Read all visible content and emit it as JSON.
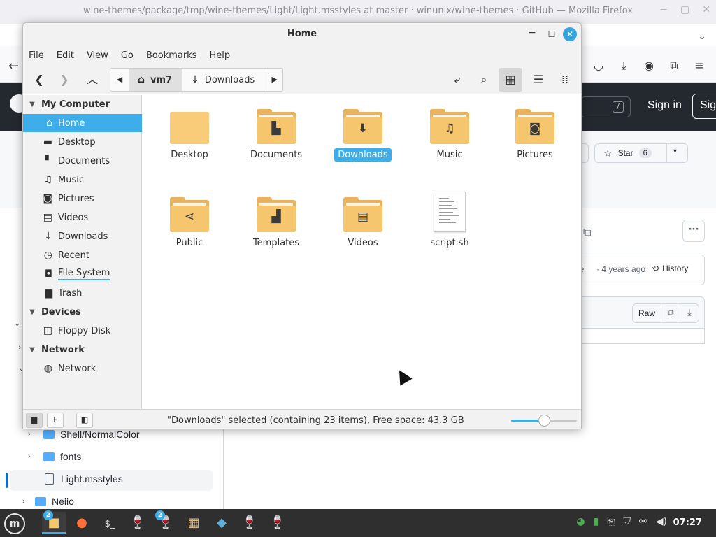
{
  "firefox": {
    "window_title": "wine-themes/package/tmp/wine-themes/Light/Light.msstyles at master · winunix/wine-themes · GitHub — Mozilla Firefox"
  },
  "github": {
    "sign_in": "Sign in",
    "sign_up": "Sig",
    "search_shortcut": "/",
    "star_label": "Star",
    "star_count": "6",
    "commit_author": "pe",
    "commit_time": "· 4 years ago",
    "history_label": "History",
    "raw_label": "Raw",
    "tree": [
      {
        "name": "Shell/NormalColor",
        "type": "folder"
      },
      {
        "name": "fonts",
        "type": "folder"
      },
      {
        "name": "Light.msstyles",
        "type": "file"
      },
      {
        "name": "Neiio",
        "type": "folder"
      }
    ]
  },
  "file_manager": {
    "title": "Home",
    "menu": [
      "File",
      "Edit",
      "View",
      "Go",
      "Bookmarks",
      "Help"
    ],
    "path": [
      {
        "label": "vm7",
        "icon": "home-icon",
        "active": true
      },
      {
        "label": "Downloads",
        "icon": "download-icon",
        "active": false
      }
    ],
    "sidebar": {
      "sections": [
        {
          "title": "My Computer",
          "items": [
            {
              "label": "Home",
              "icon": "home-icon",
              "selected": true
            },
            {
              "label": "Desktop",
              "icon": "desktop-icon"
            },
            {
              "label": "Documents",
              "icon": "document-icon"
            },
            {
              "label": "Music",
              "icon": "music-icon"
            },
            {
              "label": "Pictures",
              "icon": "camera-icon"
            },
            {
              "label": "Videos",
              "icon": "film-icon"
            },
            {
              "label": "Downloads",
              "icon": "download-icon"
            },
            {
              "label": "Recent",
              "icon": "clock-icon"
            },
            {
              "label": "File System",
              "icon": "drive-icon"
            },
            {
              "label": "Trash",
              "icon": "trash-icon"
            }
          ]
        },
        {
          "title": "Devices",
          "items": [
            {
              "label": "Floppy Disk",
              "icon": "floppy-icon"
            }
          ]
        },
        {
          "title": "Network",
          "items": [
            {
              "label": "Network",
              "icon": "globe-icon"
            }
          ]
        }
      ]
    },
    "items": [
      {
        "label": "Desktop",
        "kind": "folder-plain"
      },
      {
        "label": "Documents",
        "kind": "folder-documents"
      },
      {
        "label": "Downloads",
        "kind": "folder-downloads",
        "selected": true
      },
      {
        "label": "Music",
        "kind": "folder-music"
      },
      {
        "label": "Pictures",
        "kind": "folder-pictures"
      },
      {
        "label": "Public",
        "kind": "folder-public"
      },
      {
        "label": "Templates",
        "kind": "folder-templates"
      },
      {
        "label": "Videos",
        "kind": "folder-videos"
      },
      {
        "label": "script.sh",
        "kind": "shell-script"
      }
    ],
    "status": "\"Downloads\" selected (containing 23 items), Free space: 43.3 GB",
    "zoom_level": 0.5,
    "accent_color": "#3daee9",
    "folder_color": "#f6c66f"
  },
  "taskbar": {
    "file_manager_badge": "2",
    "wine_badge": "2",
    "clock": "07:27"
  }
}
